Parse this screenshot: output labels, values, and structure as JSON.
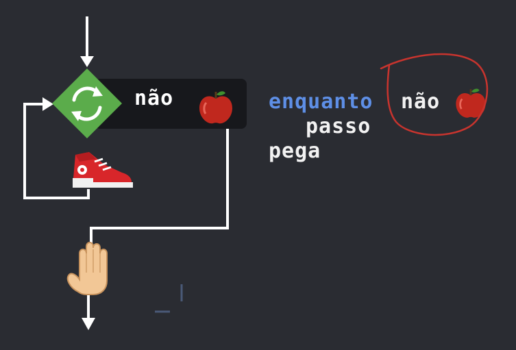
{
  "flowchart": {
    "loop_icon": "refresh-icon",
    "condition_text": "não",
    "condition_object": "apple-icon",
    "body_action": "sneaker-icon",
    "after_loop_action": "hand-icon"
  },
  "code": {
    "keyword": "enquanto",
    "condition": "não",
    "condition_object": "apple-icon",
    "body_line": "passo",
    "after_line": "pega"
  },
  "colors": {
    "background": "#2a2c32",
    "diamond": "#5bac4b",
    "keyword": "#5e8fe6",
    "text": "#f2f2f2",
    "annotation": "#c8342e",
    "apple": "#c0281e"
  }
}
